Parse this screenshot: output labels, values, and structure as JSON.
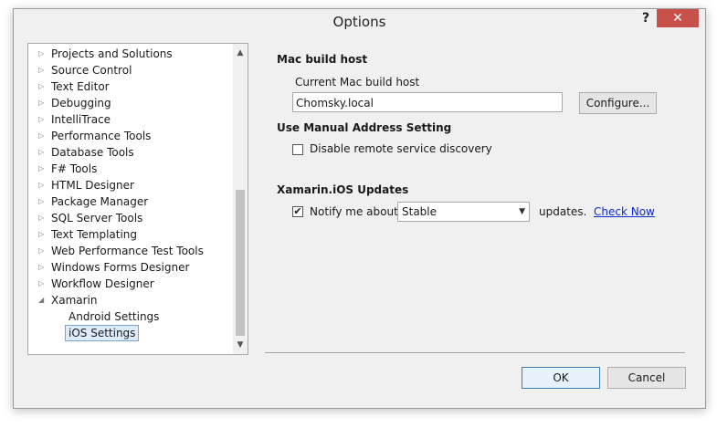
{
  "window": {
    "title": "Options",
    "help_glyph": "?",
    "close_glyph": "✕"
  },
  "tree": {
    "items": [
      {
        "label": "Projects and Solutions",
        "expander": "collapsed"
      },
      {
        "label": "Source Control",
        "expander": "collapsed"
      },
      {
        "label": "Text Editor",
        "expander": "collapsed"
      },
      {
        "label": "Debugging",
        "expander": "collapsed"
      },
      {
        "label": "IntelliTrace",
        "expander": "collapsed"
      },
      {
        "label": "Performance Tools",
        "expander": "collapsed"
      },
      {
        "label": "Database Tools",
        "expander": "collapsed"
      },
      {
        "label": "F# Tools",
        "expander": "collapsed"
      },
      {
        "label": "HTML Designer",
        "expander": "collapsed"
      },
      {
        "label": "Package Manager",
        "expander": "collapsed"
      },
      {
        "label": "SQL Server Tools",
        "expander": "collapsed"
      },
      {
        "label": "Text Templating",
        "expander": "collapsed"
      },
      {
        "label": "Web Performance Test Tools",
        "expander": "collapsed"
      },
      {
        "label": "Windows Forms Designer",
        "expander": "collapsed"
      },
      {
        "label": "Workflow Designer",
        "expander": "collapsed"
      },
      {
        "label": "Xamarin",
        "expander": "expanded"
      },
      {
        "label": "Android Settings",
        "expander": "none"
      },
      {
        "label": "iOS Settings",
        "expander": "none",
        "selected": true
      }
    ],
    "glyph_collapsed": "▷",
    "glyph_expanded": "◢",
    "scroll_up": "▲",
    "scroll_down": "▼"
  },
  "mac_build_host": {
    "heading": "Mac build host",
    "field_label": "Current Mac build host",
    "field_value": "Chomsky.local",
    "configure_button": "Configure..."
  },
  "manual_address": {
    "heading": "Use Manual Address Setting",
    "checkbox_label": "Disable remote service discovery",
    "checked": false
  },
  "updates": {
    "heading": "Xamarin.iOS Updates",
    "checkbox_label": "Notify me about",
    "checked": true,
    "check_glyph": "✔",
    "channel_selected": "Stable",
    "caret": "▼",
    "suffix": "updates.",
    "check_now_link": "Check Now"
  },
  "footer": {
    "ok_label": "OK",
    "cancel_label": "Cancel"
  }
}
